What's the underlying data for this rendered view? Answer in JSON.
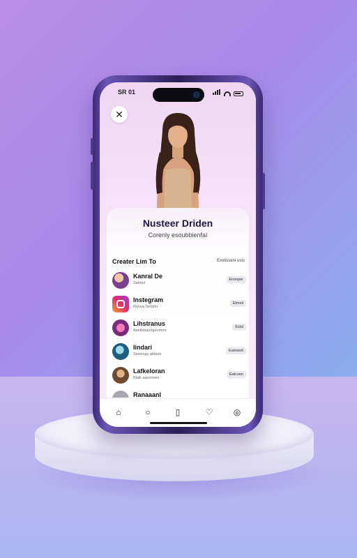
{
  "status": {
    "time": "SR 01"
  },
  "profile": {
    "name": "Nusteer Driden",
    "subtitle": "Corenly esoubbienfaí"
  },
  "section": {
    "title": "Creater Lim To",
    "link": "Exotisseni usts"
  },
  "items": [
    {
      "title": "Kanral De",
      "subtitle": "Salrsol",
      "action": "Ensnper",
      "icon": "person-avatar",
      "color": "#c06bd2"
    },
    {
      "title": "Instegram",
      "subtitle": "Riyora Serbmr",
      "action": "Etmeli",
      "icon": "instagram-icon",
      "color": "#e1306c"
    },
    {
      "title": "Lihstranus",
      "subtitle": "Asettsbaungeomnn",
      "action": "Eslsl",
      "icon": "music-avatar",
      "color": "#b7408e"
    },
    {
      "title": "Iindari",
      "subtitle": "Sswengy abbion",
      "action": "Eatowolt",
      "icon": "globe-avatar",
      "color": "#2a7fa8"
    },
    {
      "title": "Lafkeloran",
      "subtitle": "Blaik aasooven",
      "action": "Eatcoen",
      "icon": "person-avatar",
      "color": "#8a6a4a"
    },
    {
      "title": "Ranaaanl",
      "subtitle": "",
      "action": "",
      "icon": "person-avatar",
      "color": "#9a9aa2"
    }
  ],
  "tabs": [
    {
      "name": "home",
      "glyph": "⌂"
    },
    {
      "name": "search",
      "glyph": "○"
    },
    {
      "name": "shop",
      "glyph": "▯"
    },
    {
      "name": "likes",
      "glyph": "♡"
    },
    {
      "name": "profile",
      "glyph": "◎"
    }
  ],
  "close_glyph": "✕"
}
